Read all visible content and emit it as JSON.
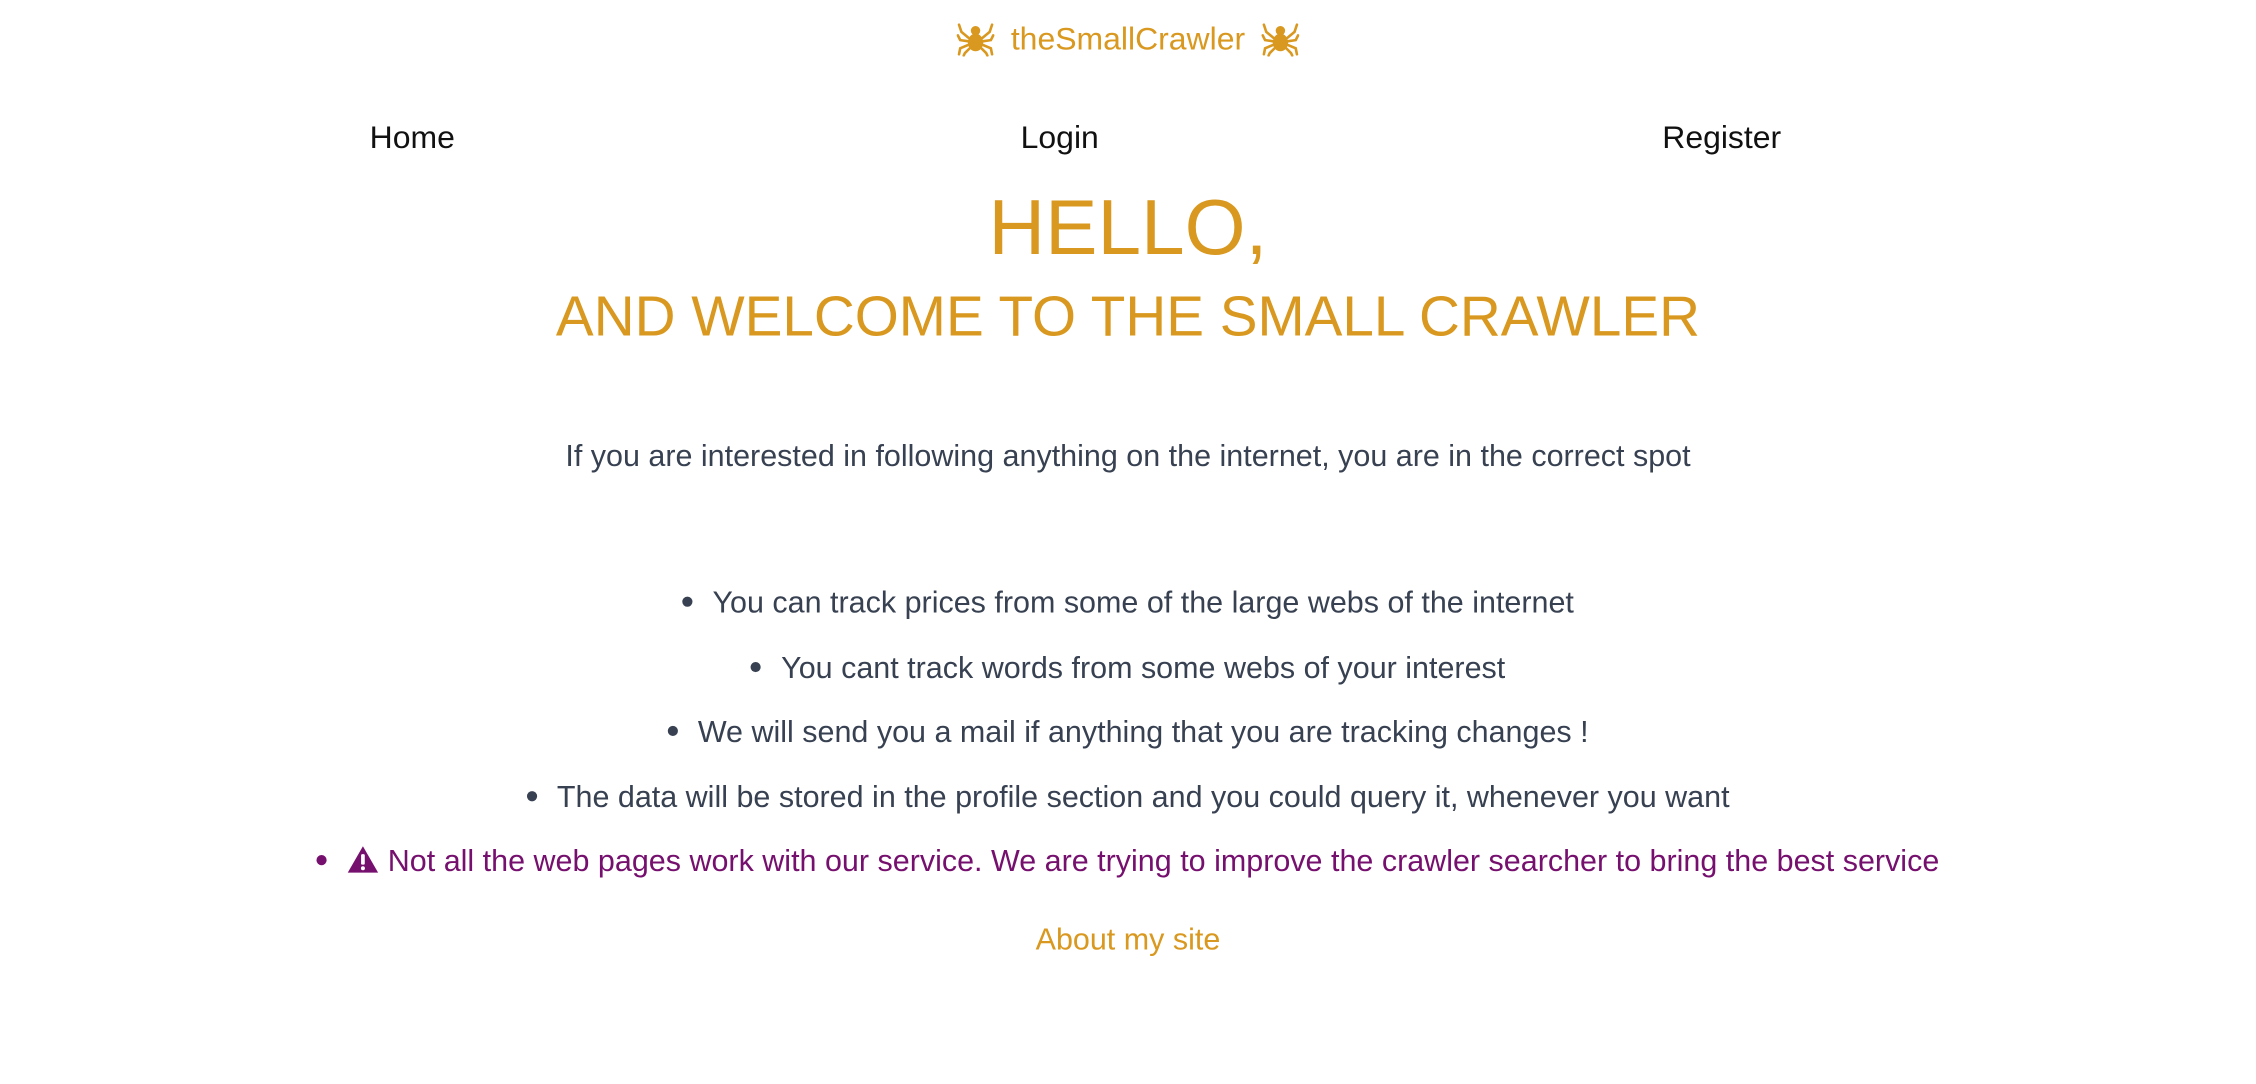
{
  "brand": {
    "title": "theSmallCrawler",
    "icon_left": "spider-icon",
    "icon_right": "spider-icon",
    "color": "#d9981f"
  },
  "nav": {
    "home": "Home",
    "login": "Login",
    "register": "Register"
  },
  "hero": {
    "greeting": "HELLO,",
    "welcome": "AND WELCOME TO THE SMALL CRAWLER"
  },
  "intro": "If you are interested in following anything on the internet, you are in the correct spot",
  "features": [
    "You can track prices from some of the large webs of the internet",
    "You cant track words from some webs of your interest",
    "We will send you a mail if anything that you are tracking changes !",
    "The data will be stored in the profile section and you could query it, whenever you want"
  ],
  "warning": {
    "icon": "warning-icon",
    "text": "Not all the web pages work with our service. We are trying to improve the crawler searcher to bring the best service",
    "color": "#76106e"
  },
  "footer": {
    "about_link": "About my site"
  }
}
